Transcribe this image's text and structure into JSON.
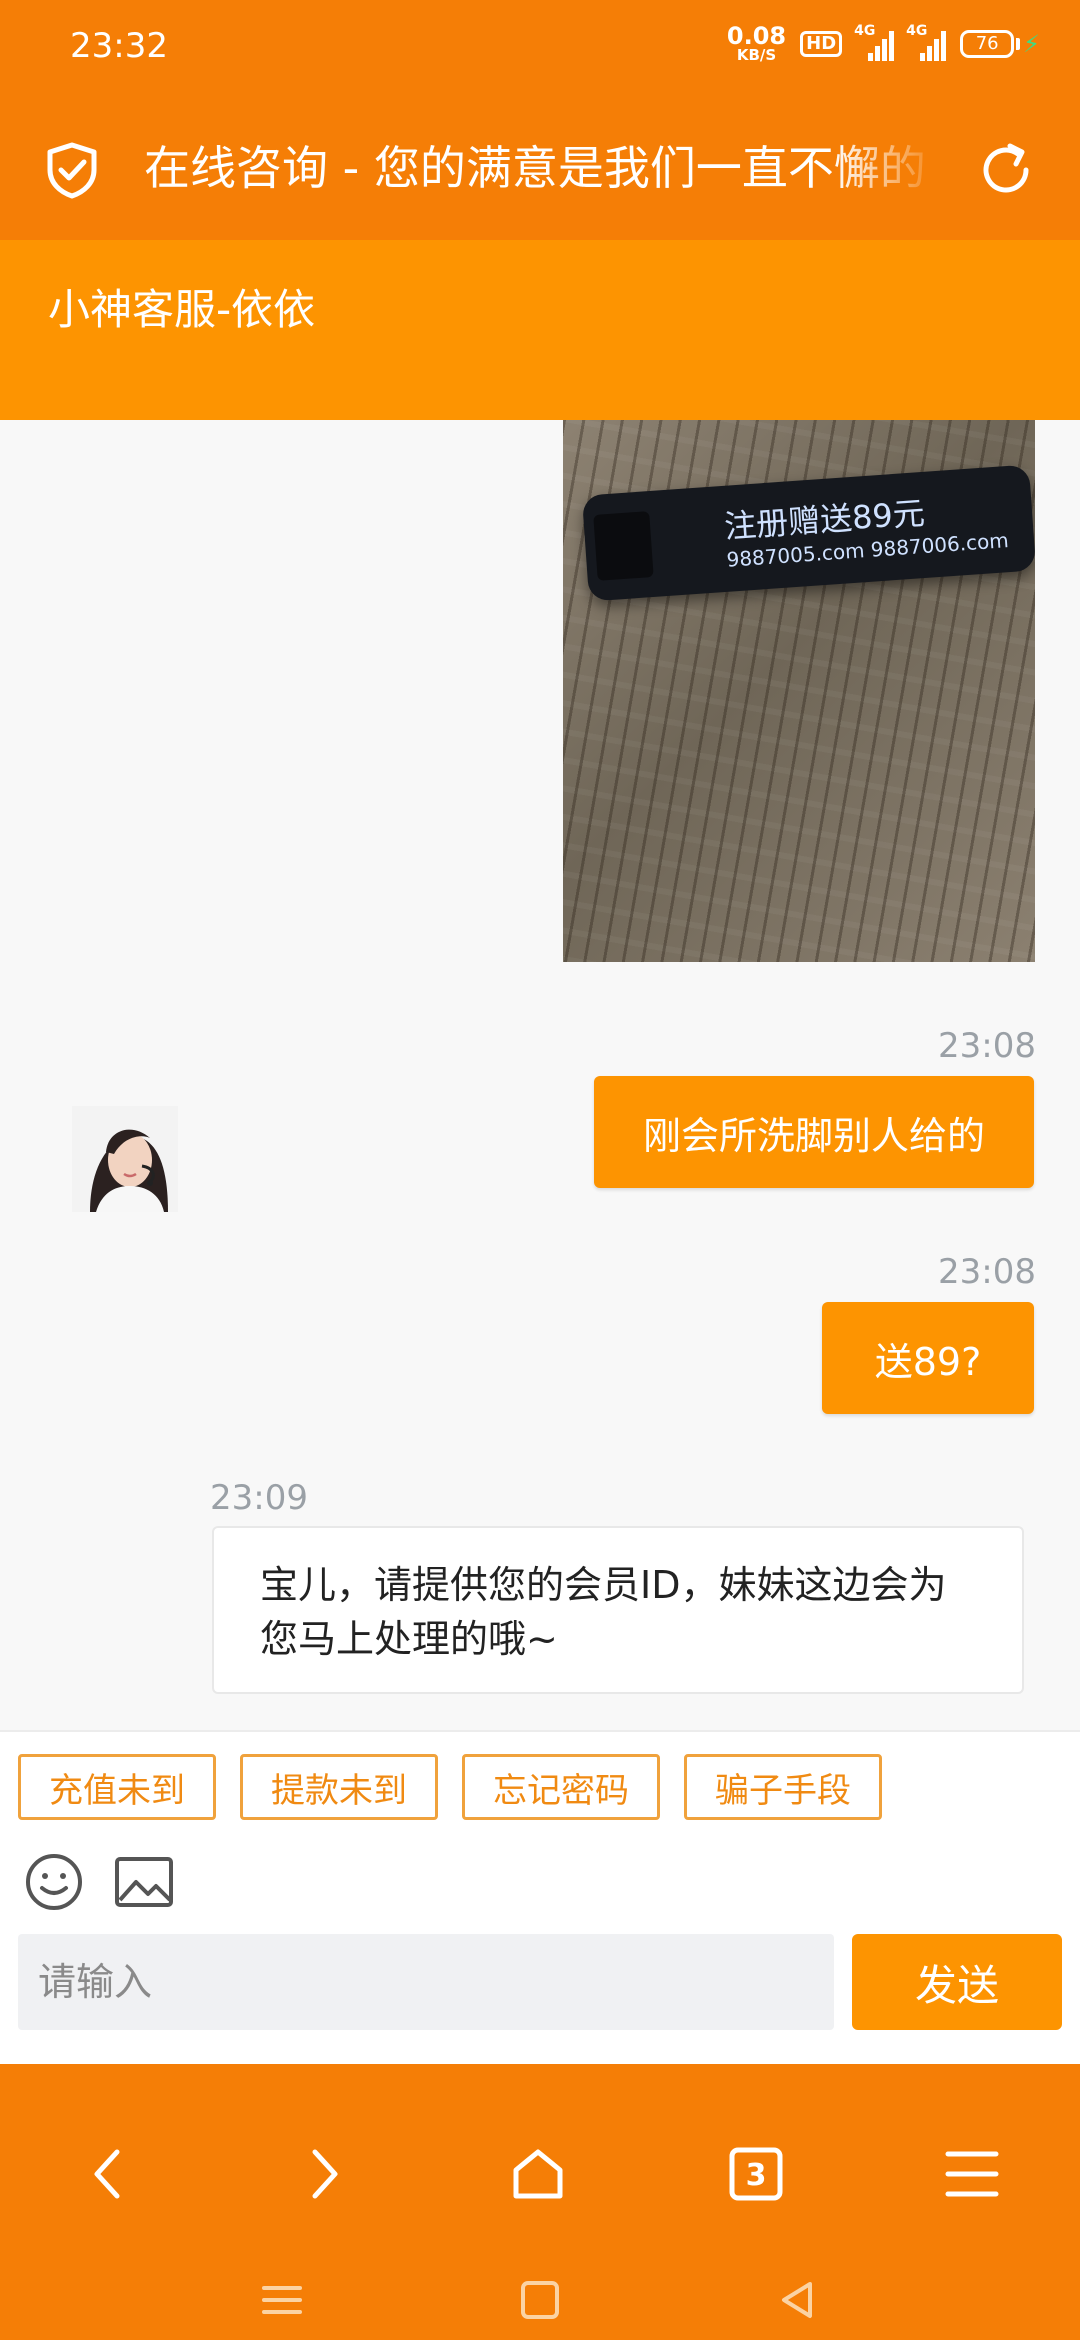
{
  "status_bar": {
    "time": "23:32",
    "net_speed": "0.08",
    "net_unit": "KB/S",
    "hd_label": "HD",
    "signal1_label": "4G",
    "signal2_label": "4G",
    "battery": "76"
  },
  "header": {
    "title": "在线咨询 - 您的满意是我们一直不懈的"
  },
  "agent": {
    "name": "小神客服-依依"
  },
  "image_message": {
    "caption_line1": "注册赠送89元",
    "caption_line2": "9887005.com 9887006.com"
  },
  "messages": [
    {
      "time": "23:08",
      "text": "刚会所洗脚别人给的",
      "from": "user"
    },
    {
      "time": "23:08",
      "text": "送89?",
      "from": "user"
    },
    {
      "time": "23:09",
      "text": "宝儿，请提供您的会员ID，妹妹这边会为您马上处理的哦~",
      "from": "agent"
    }
  ],
  "quick_replies": [
    "充值未到",
    "提款未到",
    "忘记密码",
    "骗子手段"
  ],
  "input": {
    "placeholder": "请输入",
    "send_label": "发送"
  },
  "browser_nav": {
    "tab_count": "3"
  },
  "icons": {
    "shield": "shield-check-icon",
    "refresh": "refresh-icon",
    "emoji": "emoji-icon",
    "image": "image-icon",
    "back": "chevron-left-icon",
    "forward": "chevron-right-icon",
    "home": "home-icon",
    "tabs": "tabs-icon",
    "menu": "menu-icon"
  },
  "colors": {
    "primary": "#f57e06",
    "accent": "#fd9401",
    "quick_border": "#f0a23c"
  }
}
